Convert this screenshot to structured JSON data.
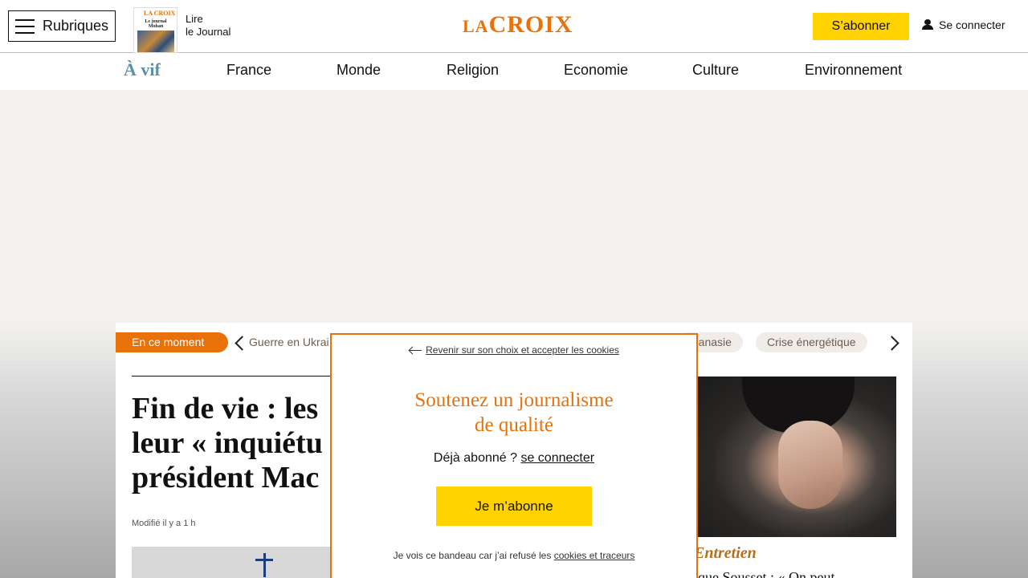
{
  "header": {
    "rubriques_label": "Rubriques",
    "journal": {
      "line1": "Lire",
      "line2": "le Journal",
      "thumb_logo": "LA CROIX",
      "thumb_headline": "Le journal Mohan"
    },
    "logo": {
      "small": "LA",
      "big": "CROIX"
    },
    "subscribe_label": "S’abonner",
    "login_label": "Se connecter"
  },
  "nav": {
    "items": [
      "À vif",
      "France",
      "Monde",
      "Religion",
      "Economie",
      "Culture",
      "Environnement"
    ]
  },
  "topics": {
    "label": "En ce moment",
    "pills": [
      "Guerre en Ukrai",
      "thanasie",
      "Crise énergétique"
    ]
  },
  "article": {
    "headline_lines": [
      "Fin de vie : les",
      "leur « inquiétu",
      "président Mac"
    ],
    "modified": "Modifié il y a 1 h"
  },
  "side_card": {
    "kicker": "Entretien",
    "title": "ique Sousset : « On peut"
  },
  "modal": {
    "back_link": "Revenir sur son choix et accepter les cookies",
    "title_line1": "Soutenez un journalisme",
    "title_line2": "de qualité",
    "already_text": "Déjà abonné ? ",
    "already_link": "se connecter",
    "subscribe_button": "Je m’abonne",
    "refused_text": "Je vois ce bandeau car j’ai refusé les ",
    "refused_link": "cookies et traceurs"
  },
  "colors": {
    "accent": "#e8710a",
    "subscribe": "#ffd200",
    "avif": "#5e8fa6",
    "kicker": "#b5701d"
  }
}
